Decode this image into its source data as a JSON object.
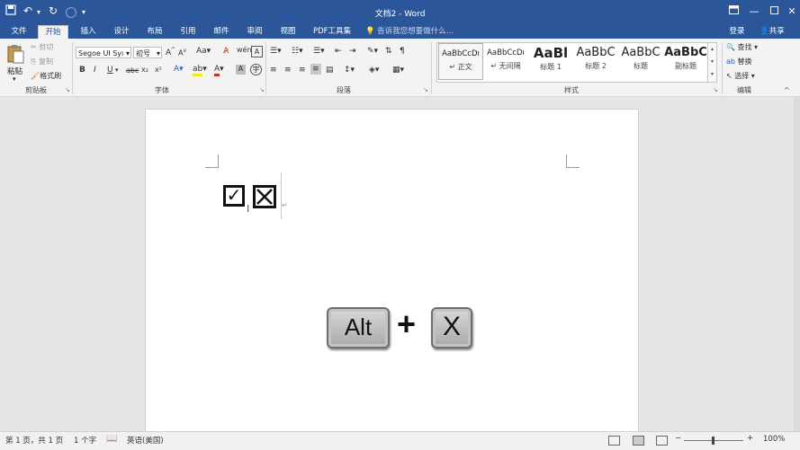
{
  "titlebar": {
    "title": "文档2 - Word",
    "qa_save_icon": "save-icon",
    "qa_undo": "↶",
    "qa_redo": "↻",
    "qa_more": "▾"
  },
  "tabs": [
    {
      "label": "文件"
    },
    {
      "label": "开始"
    },
    {
      "label": "插入"
    },
    {
      "label": "设计"
    },
    {
      "label": "布局"
    },
    {
      "label": "引用"
    },
    {
      "label": "邮件"
    },
    {
      "label": "审阅"
    },
    {
      "label": "视图"
    },
    {
      "label": "PDF工具集"
    }
  ],
  "tellme": "告诉我您想要做什么...",
  "signin": "登录",
  "share": "共享",
  "clipboard": {
    "paste": "粘贴",
    "cut": "剪切",
    "copy": "复制",
    "format_painter": "格式刷",
    "group": "剪贴板"
  },
  "font": {
    "name": "Segoe UI Syı",
    "size": "初号",
    "group": "字体",
    "grow": "A",
    "shrink": "A",
    "case": "Aa",
    "bold": "B",
    "italic": "I",
    "underline": "U",
    "strike": "abc",
    "sub": "x₂",
    "sup": "x²"
  },
  "paragraph": {
    "group": "段落"
  },
  "styles": {
    "group": "样式",
    "items": [
      {
        "sample": "AaBbCcDı",
        "name": "正文",
        "mark": "↵"
      },
      {
        "sample": "AaBbCcDı",
        "name": "无间隔",
        "mark": "↵"
      },
      {
        "sample": "AaBl",
        "name": "标题 1",
        "mark": ""
      },
      {
        "sample": "AaBbC",
        "name": "标题 2",
        "mark": ""
      },
      {
        "sample": "AaBbC",
        "name": "标题",
        "mark": ""
      },
      {
        "sample": "AaBbC",
        "name": "副标题",
        "mark": ""
      }
    ]
  },
  "editing": {
    "find": "查找",
    "replace": "替换",
    "select": "选择",
    "group": "编辑"
  },
  "document": {
    "checked_box": "☑",
    "crossed_box": "☒",
    "para_mark": "↵"
  },
  "shortcut": {
    "key1": "Alt",
    "plus": "+",
    "key2": "X"
  },
  "status": {
    "page": "第 1 页，共 1 页",
    "words": "1 个字",
    "language": "英语(美国)",
    "zoom": "100%",
    "zoom_minus": "−",
    "zoom_plus": "+"
  },
  "colors": {
    "brand": "#2b579a",
    "ribbon": "#f3f3f3"
  }
}
